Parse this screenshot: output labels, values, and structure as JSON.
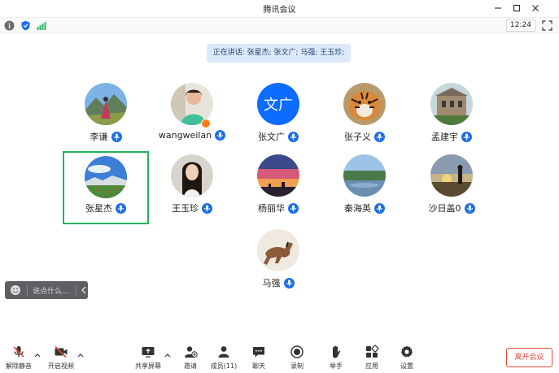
{
  "window": {
    "title": "腾讯会议"
  },
  "status": {
    "time": "12:24"
  },
  "speaking": {
    "text": "正在讲话: 张星杰; 张文广; 马强; 王玉珍;"
  },
  "participants": [
    {
      "name": "李谦",
      "avatar": "mountain-landscape-person",
      "mic": "on"
    },
    {
      "name": "wangweilan",
      "avatar": "woman-portrait",
      "mic": "on",
      "badge": "host-badge"
    },
    {
      "name": "张文广",
      "avatar_text": "文广",
      "mic": "on"
    },
    {
      "name": "张子义",
      "avatar": "tiger-photo",
      "mic": "on"
    },
    {
      "name": "孟建宇",
      "avatar": "building-photo",
      "mic": "on"
    },
    {
      "name": "张星杰",
      "avatar": "sky-meadow-photo",
      "mic": "on",
      "selected": true
    },
    {
      "name": "王玉珍",
      "avatar": "woman-long-hair",
      "mic": "on"
    },
    {
      "name": "杨丽华",
      "avatar": "sunset-sky-photo",
      "mic": "on"
    },
    {
      "name": "秦海英",
      "avatar": "lake-trees-photo",
      "mic": "on"
    },
    {
      "name": "沙日盖0",
      "avatar": "sunset-photographer",
      "mic": "on"
    },
    {
      "name": "马强",
      "avatar": "horse-photo",
      "mic": "on"
    }
  ],
  "chat": {
    "placeholder": "说点什么..."
  },
  "toolbar": {
    "unmute": "解除静音",
    "start_video": "开启视频",
    "share_screen": "共享屏幕",
    "invite": "邀请",
    "members": "成员(11)",
    "chat": "聊天",
    "record": "录制",
    "raise_hand": "举手",
    "apps": "应用",
    "settings": "设置",
    "leave": "离开会议"
  },
  "colors": {
    "accent": "#1e6fe6",
    "selected_border": "#25b35b",
    "leave_red": "#e64a3b",
    "banner_bg": "#dce9fb"
  }
}
